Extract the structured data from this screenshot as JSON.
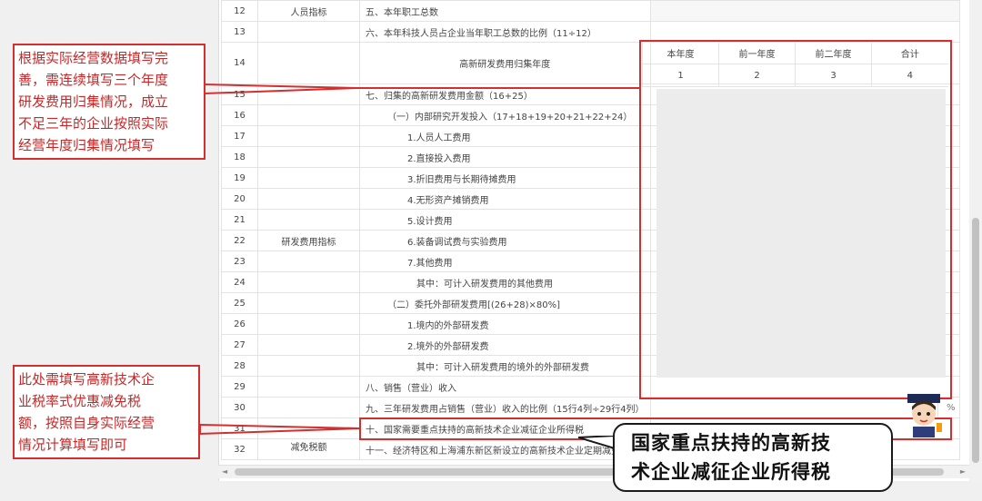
{
  "table": {
    "rows": [
      {
        "num": "12",
        "cat": "人员指标",
        "content": "五、本年职工总数"
      },
      {
        "num": "13",
        "cat": "",
        "content": "六、本年科技人员占企业当年职工总数的比例（11÷12）"
      },
      {
        "num": "14",
        "cat": "",
        "content": "高新研发费用归集年度"
      },
      {
        "num": "15",
        "cat": "",
        "content": "七、归集的高新研发费用金额（16+25）"
      },
      {
        "num": "16",
        "cat": "",
        "content": "（一）内部研究开发投入（17+18+19+20+21+22+24）"
      },
      {
        "num": "17",
        "cat": "",
        "content": "1.人员人工费用"
      },
      {
        "num": "18",
        "cat": "",
        "content": "2.直接投入费用"
      },
      {
        "num": "19",
        "cat": "",
        "content": "3.折旧费用与长期待摊费用"
      },
      {
        "num": "20",
        "cat": "",
        "content": "4.无形资产摊销费用"
      },
      {
        "num": "21",
        "cat": "",
        "content": "5.设计费用"
      },
      {
        "num": "22",
        "cat": "研发费用指标",
        "content": "6.装备调试费与实验费用"
      },
      {
        "num": "23",
        "cat": "",
        "content": "7.其他费用"
      },
      {
        "num": "24",
        "cat": "",
        "content": "其中：可计入研发费用的其他费用"
      },
      {
        "num": "25",
        "cat": "",
        "content": "（二）委托外部研发费用[(26+28)×80%]"
      },
      {
        "num": "26",
        "cat": "",
        "content": "1.境内的外部研发费"
      },
      {
        "num": "27",
        "cat": "",
        "content": "2.境外的外部研发费"
      },
      {
        "num": "28",
        "cat": "",
        "content": "其中：可计入研发费用的境外的外部研发费"
      },
      {
        "num": "29",
        "cat": "",
        "content": "八、销售（营业）收入"
      },
      {
        "num": "30",
        "cat": "",
        "content": "九、三年研发费用占销售（营业）收入的比例（15行4列÷29行4列）",
        "pct": "%"
      },
      {
        "num": "31",
        "cat": "",
        "content": "十、国家需要重点扶持的高新技术企业减征企业所得税"
      },
      {
        "num": "32",
        "cat": "减免税额",
        "content": "十一、经济特区和上海浦东新区新设立的高新技术企业定期减免"
      }
    ]
  },
  "years": {
    "headers": [
      "本年度",
      "前一年度",
      "前二年度",
      "合计"
    ],
    "indices": [
      "1",
      "2",
      "3",
      "4"
    ]
  },
  "annotations": {
    "top_note": [
      "根据实际经营数据填写完",
      "善，需连续填写三个年度",
      "研发费用归集情况，成立",
      "不足三年的企业按照实际",
      "经营年度归集情况填写"
    ],
    "bottom_note": [
      "此处需填写高新技术企",
      "业税率式优惠减免税",
      "额，按照自身实际经营",
      "情况计算填写即可"
    ],
    "callout": [
      "国家重点扶持的高新技",
      "术企业减征企业所得税"
    ]
  },
  "colors": {
    "annotation_red": "#d32f2f",
    "callout_border": "#1a1a1a"
  }
}
